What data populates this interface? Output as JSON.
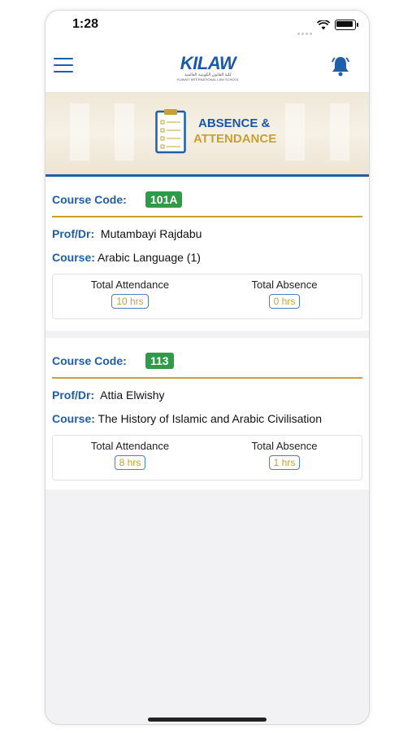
{
  "status_bar": {
    "time": "1:28"
  },
  "navbar": {
    "logo": "KILAW",
    "logo_sub_ar": "كلية القانون الكويتية العالمية",
    "logo_sub_en": "KUWAIT INTERNATIONAL LAW SCHOOL"
  },
  "banner": {
    "title_line1": "ABSENCE &",
    "title_line2": "ATTENDANCE"
  },
  "courses": [
    {
      "code_label": "Course Code:",
      "code": "101A",
      "prof_label": "Prof/Dr:",
      "prof": "Mutambayi Rajdabu",
      "course_label": "Course:",
      "course": "Arabic Language (1)",
      "attendance_label": "Total Attendance",
      "attendance": "10 hrs",
      "absence_label": "Total Absence",
      "absence": "0 hrs"
    },
    {
      "code_label": "Course Code:",
      "code": "113",
      "prof_label": "Prof/Dr:",
      "prof": "Attia Elwishy",
      "course_label": "Course:",
      "course": "The History of Islamic and Arabic Civilisation",
      "attendance_label": "Total Attendance",
      "attendance": "8 hrs",
      "absence_label": "Total Absence",
      "absence": "1 hrs"
    }
  ],
  "colors": {
    "primary": "#1f5ea8",
    "gold": "#c9a033",
    "badge": "#2e9b48"
  },
  "icons": {
    "menu": "hamburger-menu-icon",
    "bell": "notification-bell-icon",
    "clipboard": "clipboard-checklist-icon"
  }
}
